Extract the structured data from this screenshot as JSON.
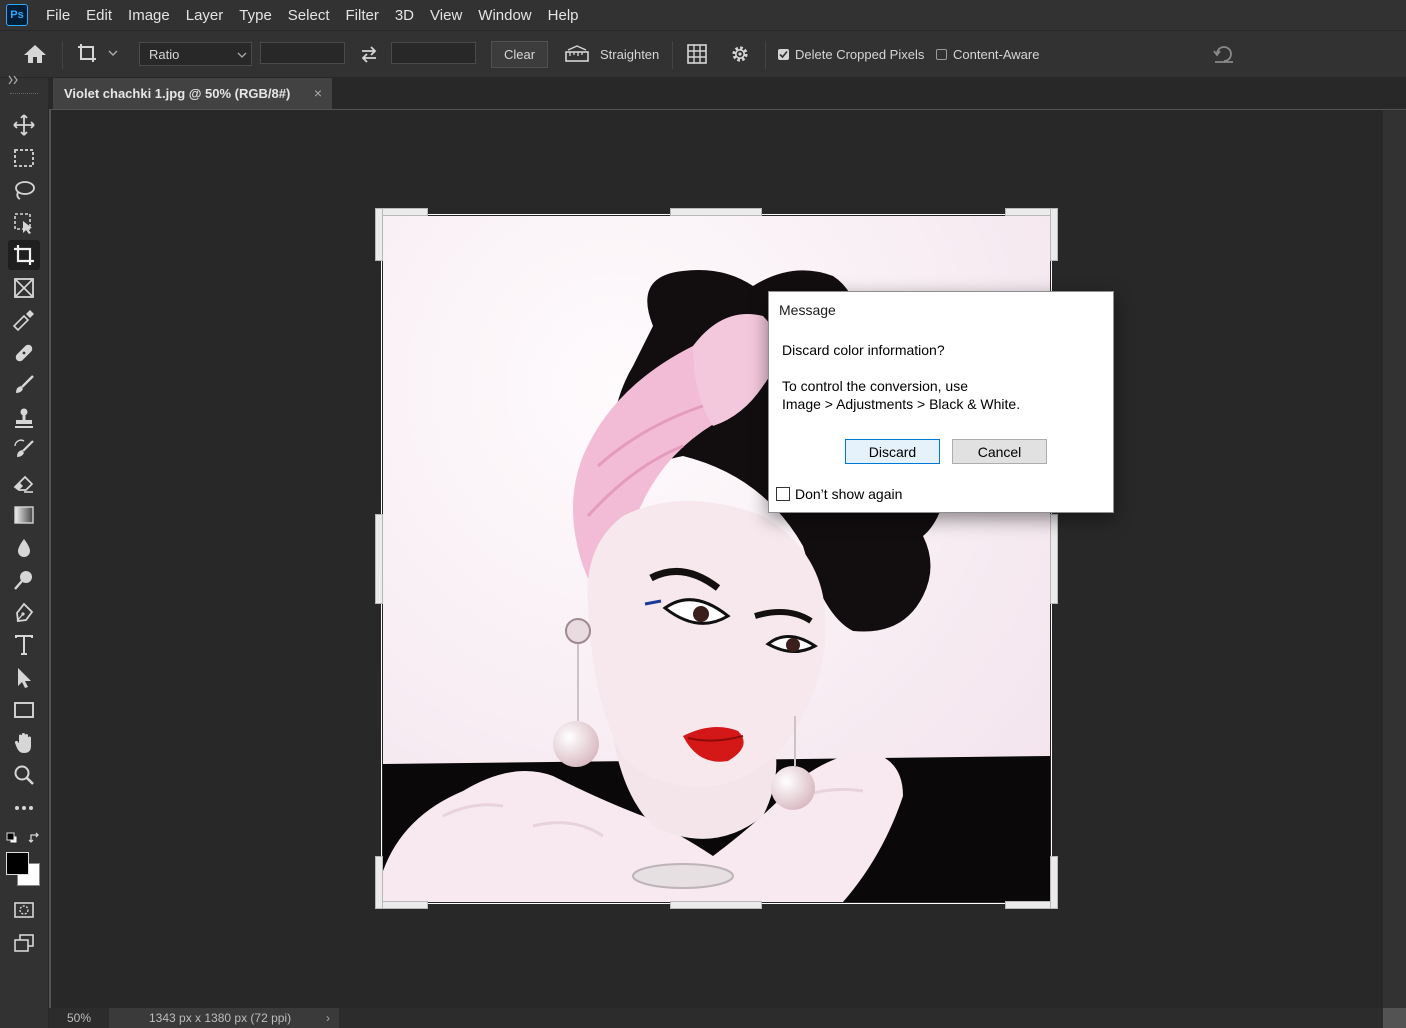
{
  "app": {
    "logo_text": "Ps"
  },
  "menu": [
    "File",
    "Edit",
    "Image",
    "Layer",
    "Type",
    "Select",
    "Filter",
    "3D",
    "View",
    "Window",
    "Help"
  ],
  "options_bar": {
    "ratio_select": "Ratio",
    "clear_label": "Clear",
    "straighten_label": "Straighten",
    "delete_cropped_label": "Delete Cropped Pixels",
    "delete_cropped_checked": true,
    "content_aware_label": "Content-Aware",
    "content_aware_checked": false
  },
  "document": {
    "tab_title": "Violet chachki 1.jpg @ 50% (RGB/8#)",
    "close_glyph": "×"
  },
  "status": {
    "zoom": "50%",
    "info": "1343 px x 1380 px (72 ppi)",
    "arrow": "›"
  },
  "dialog": {
    "title": "Message",
    "question": "Discard color information?",
    "line1": "To control the conversion, use",
    "line2": "Image > Adjustments > Black & White.",
    "discard_label": "Discard",
    "cancel_label": "Cancel",
    "dont_show_label": "Don’t show again"
  },
  "colors": {
    "accent": "#31a8ff",
    "foreground_swatch": "#000000",
    "background_swatch": "#ffffff",
    "dialog_primary_border": "#0078d7"
  }
}
